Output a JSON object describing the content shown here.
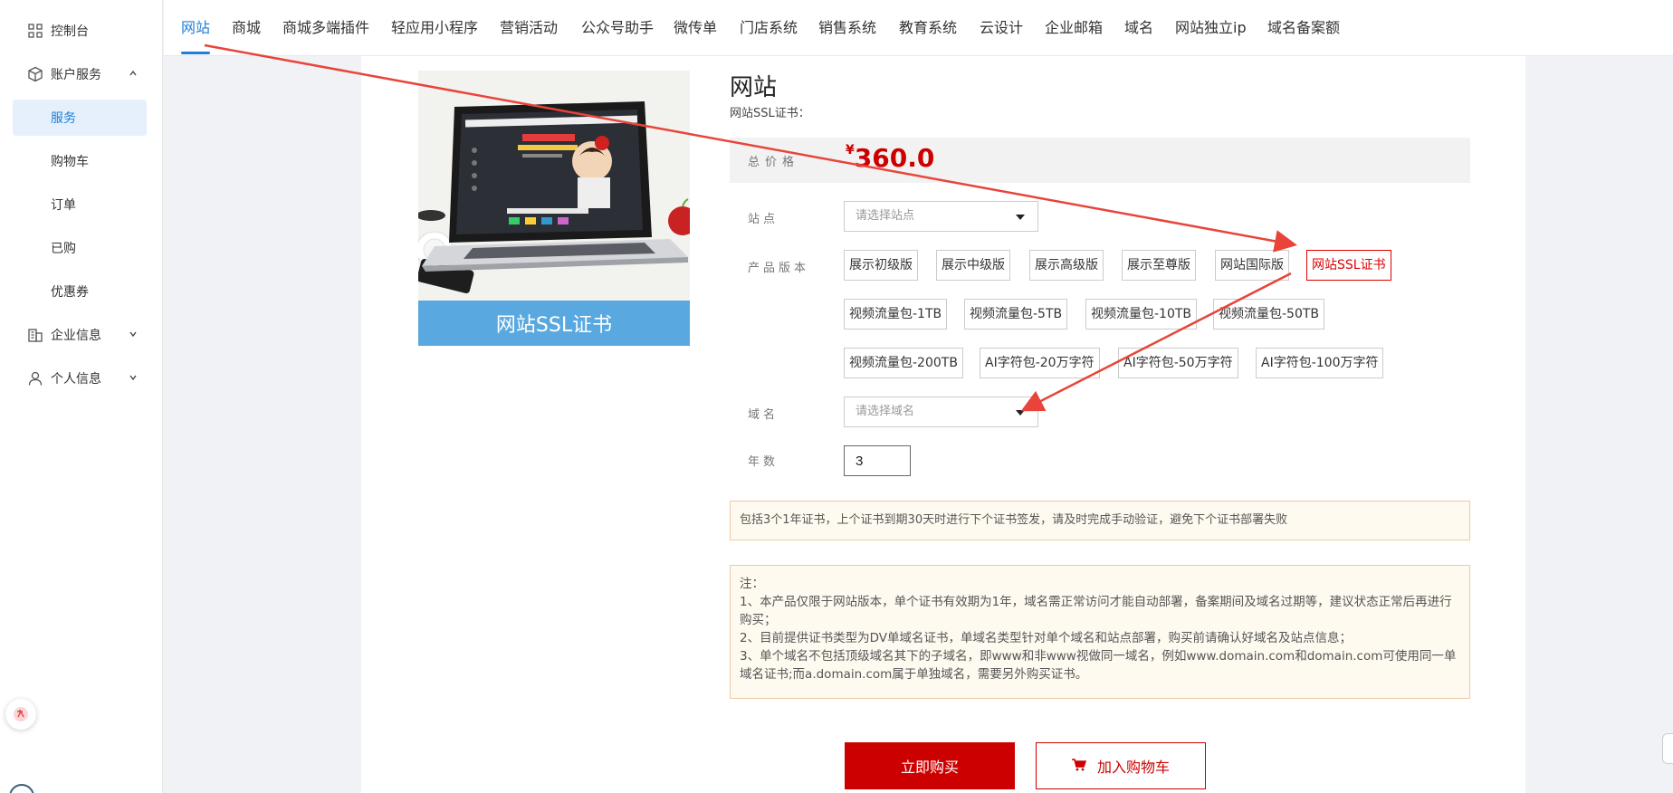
{
  "sidebar": {
    "items": [
      {
        "label": "控制台",
        "icon": "grid-icon"
      },
      {
        "label": "账户服务",
        "icon": "cube-icon",
        "expanded": true
      },
      {
        "label": "企业信息",
        "icon": "building-icon",
        "expanded": false
      },
      {
        "label": "个人信息",
        "icon": "user-icon",
        "expanded": false
      }
    ],
    "sub_items": [
      {
        "label": "服务",
        "active": true
      },
      {
        "label": "购物车"
      },
      {
        "label": "订单"
      },
      {
        "label": "已购"
      },
      {
        "label": "优惠券"
      }
    ]
  },
  "topnav": {
    "tabs": [
      "网站",
      "商城",
      "商城多端插件",
      "轻应用小程序",
      "营销活动",
      "公众号助手",
      "微传单",
      "门店系统",
      "销售系统",
      "教育系统",
      "云设计",
      "企业邮箱",
      "域名",
      "网站独立ip",
      "域名备案额"
    ],
    "active": "网站"
  },
  "product": {
    "caption": "网站SSL证书",
    "title": "网站",
    "subtitle": "网站SSL证书：",
    "price_label": "总价格",
    "currency": "¥",
    "price": "360.0"
  },
  "form": {
    "site_label": "站点",
    "site_placeholder": "请选择站点",
    "version_label": "产品版本",
    "versions": [
      "展示初级版",
      "展示中级版",
      "展示高级版",
      "展示至尊版",
      "网站国际版",
      "网站SSL证书",
      "视频流量包-1TB",
      "视频流量包-5TB",
      "视频流量包-10TB",
      "视频流量包-50TB",
      "视频流量包-200TB",
      "AI字符包-20万字符",
      "AI字符包-50万字符",
      "AI字符包-100万字符"
    ],
    "selected_version": "网站SSL证书",
    "domain_label": "域名",
    "domain_placeholder": "请选择域名",
    "years_label": "年数",
    "years_value": "3"
  },
  "notice": "包括3个1年证书，上个证书到期30天时进行下个证书签发，请及时完成手动验证，避免下个证书部署失败",
  "notes": [
    "注：",
    "1、本产品仅限于网站版本，单个证书有效期为1年，域名需正常访问才能自动部署，备案期间及域名过期等，建议状态正常后再进行购买；",
    "2、目前提供证书类型为DV单域名证书，单域名类型针对单个域名和站点部署，购买前请确认好域名及站点信息；",
    "3、单个域名不包括顶级域名其下的子域名，即www和非www视做同一域名，例如www.domain.com和domain.com可使用同一单域名证书;而a.domain.com属于单独域名，需要另外购买证书。"
  ],
  "actions": {
    "buy": "立即购买",
    "cart": "加入购物车"
  },
  "colors": {
    "accent": "#1e7ed8",
    "price": "#cc0000",
    "annotation_arrow": "#e8443a"
  }
}
